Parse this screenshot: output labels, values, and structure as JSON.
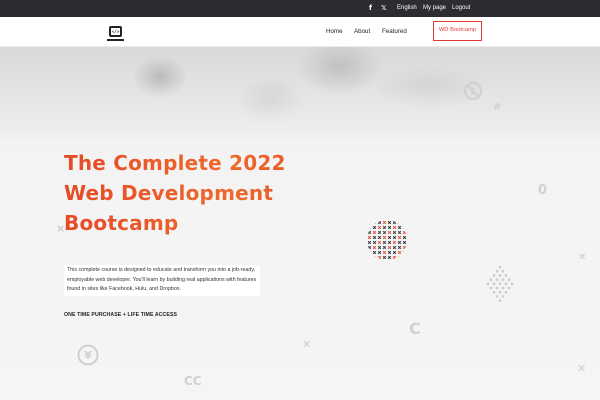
{
  "topbar": {
    "facebook_icon": "f",
    "twitter_icon": "𝕏",
    "language": "English",
    "my_page": "My page",
    "logout": "Logout"
  },
  "navbar": {
    "links": [
      "Home",
      "About",
      "Featured"
    ],
    "cta": "WD Bootcamp"
  },
  "hero": {
    "title_lines": [
      "The Complete 2022",
      "Web Development",
      "Bootcamp"
    ],
    "description": "This complete course is designed to educate and transform you into a job-ready, employable web developer. You'll learn by building real applications with features found in sites like Facebook, Hulu, and Dropbox.",
    "tagline": "ONE TIME PURCHASE + LIFE TIME ACCESS"
  },
  "colors": {
    "topbar_bg": "#2b2d33",
    "accent": "#e53935",
    "title_gradient_start": "#e54a26",
    "title_gradient_end": "#ef6a2d",
    "pattern_dark": "#2b2d33",
    "pattern_red": "#e8452a"
  },
  "icons": {
    "logo": "laptop-code-icon",
    "social": [
      "facebook-icon",
      "twitter-icon"
    ],
    "decorations": [
      "no-sign-icon",
      "hash-icon",
      "zero-glyph",
      "plus-icon",
      "c-glyph",
      "yen-icon",
      "diamond-dot-pattern",
      "circle-dot-pattern"
    ]
  }
}
